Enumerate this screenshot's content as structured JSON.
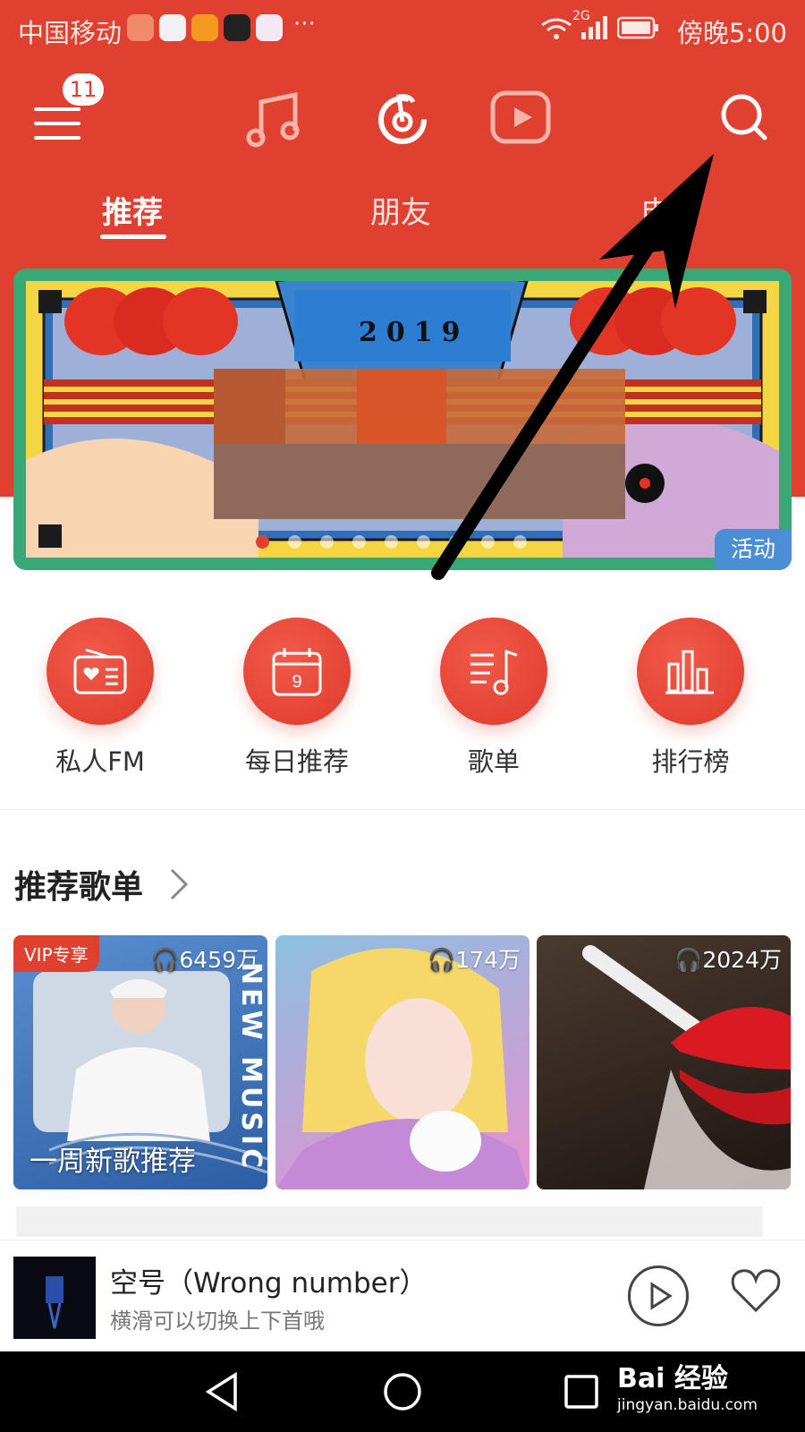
{
  "status_bar": {
    "carrier": "中国移动",
    "network": "2G",
    "time": "傍晚5:00",
    "more": "···"
  },
  "header": {
    "menu_badge": "11",
    "icons": [
      "menu-icon",
      "music-note-icon",
      "netease-logo-icon",
      "video-play-icon",
      "search-icon"
    ]
  },
  "tabs": [
    {
      "label": "推荐",
      "active": true
    },
    {
      "label": "朋友",
      "active": false
    },
    {
      "label": "电台",
      "active": false
    }
  ],
  "banner": {
    "year": "2019",
    "tag": "活动",
    "dots": 9,
    "active_dot": 0
  },
  "shortcuts": [
    {
      "label": "私人FM",
      "icon": "radio-icon"
    },
    {
      "label": "每日推荐",
      "icon": "calendar-icon",
      "icon_text": "9"
    },
    {
      "label": "歌单",
      "icon": "playlist-icon"
    },
    {
      "label": "排行榜",
      "icon": "chart-bars-icon"
    }
  ],
  "section": {
    "title": "推荐歌单"
  },
  "playlists": [
    {
      "count": "6459万",
      "vip": "VIP专享",
      "caption": "一周新歌推荐",
      "side_text": "NEW MUSIC"
    },
    {
      "count": "174万"
    },
    {
      "count": "2024万"
    }
  ],
  "player": {
    "title": "空号（Wrong number）",
    "subtitle": "横滑可以切换上下首哦"
  },
  "watermark": {
    "brand": "Bai  经验",
    "url": "jingyan.baidu.com"
  },
  "colors": {
    "brand_red": "#e0402f",
    "text_dark": "#222222"
  }
}
